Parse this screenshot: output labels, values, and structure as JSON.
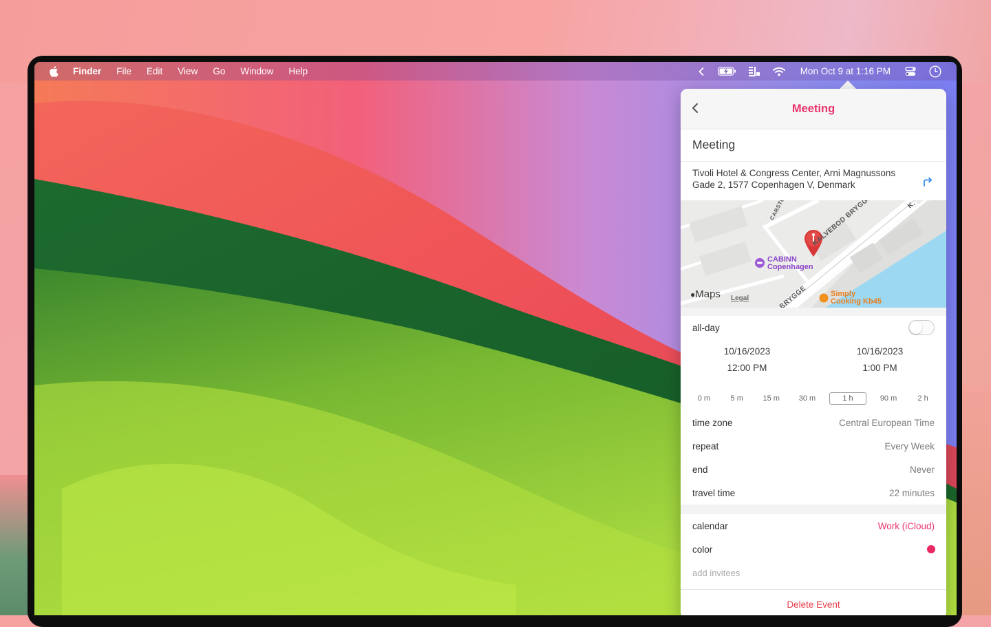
{
  "menubar": {
    "items": [
      "Finder",
      "File",
      "Edit",
      "View",
      "Go",
      "Window",
      "Help"
    ],
    "clock": "Mon Oct 9 at 1:16 PM",
    "icons": [
      "chevron-left-icon",
      "battery-charging-icon",
      "focus-icon",
      "wifi-icon",
      "control-center-icon",
      "clock-icon"
    ]
  },
  "popover": {
    "header_title": "Meeting",
    "event_title": "Meeting",
    "location": "Tivoli Hotel & Congress Center, Arni Magnussons Gade 2, 1577 Copenhagen V, Denmark",
    "map": {
      "poi_1": "CABINN Copenhagen",
      "poi_1_line1": "CABINN",
      "poi_1_line2": "Copenhagen",
      "poi_2_line1": "Simply",
      "poi_2_line2": "Cooking Kb45",
      "road_1": "KALVEBOD BRYGGE",
      "road_2": "BRYGGE",
      "road_3": "CARSTE",
      "road_4": "K.",
      "brand": "Maps",
      "legal": "Legal"
    },
    "allday_label": "all-day",
    "allday_on": false,
    "start_date": "10/16/2023",
    "start_time": "12:00 PM",
    "end_date": "10/16/2023",
    "end_time": "1:00 PM",
    "durations": [
      "0 m",
      "5 m",
      "15 m",
      "30 m",
      "1 h",
      "90 m",
      "2 h"
    ],
    "selected_duration": "1 h",
    "time_zone_label": "time zone",
    "time_zone_value": "Central European Time",
    "repeat_label": "repeat",
    "repeat_value": "Every Week",
    "end_label": "end",
    "end_value": "Never",
    "travel_label": "travel time",
    "travel_value": "22 minutes",
    "calendar_label": "calendar",
    "calendar_value": "Work (iCloud)",
    "color_label": "color",
    "color_value": "#e92a62",
    "invitees_placeholder": "add invitees",
    "delete_label": "Delete Event"
  },
  "colors": {
    "accent": "#e9336a",
    "delete": "#e63e4a"
  }
}
